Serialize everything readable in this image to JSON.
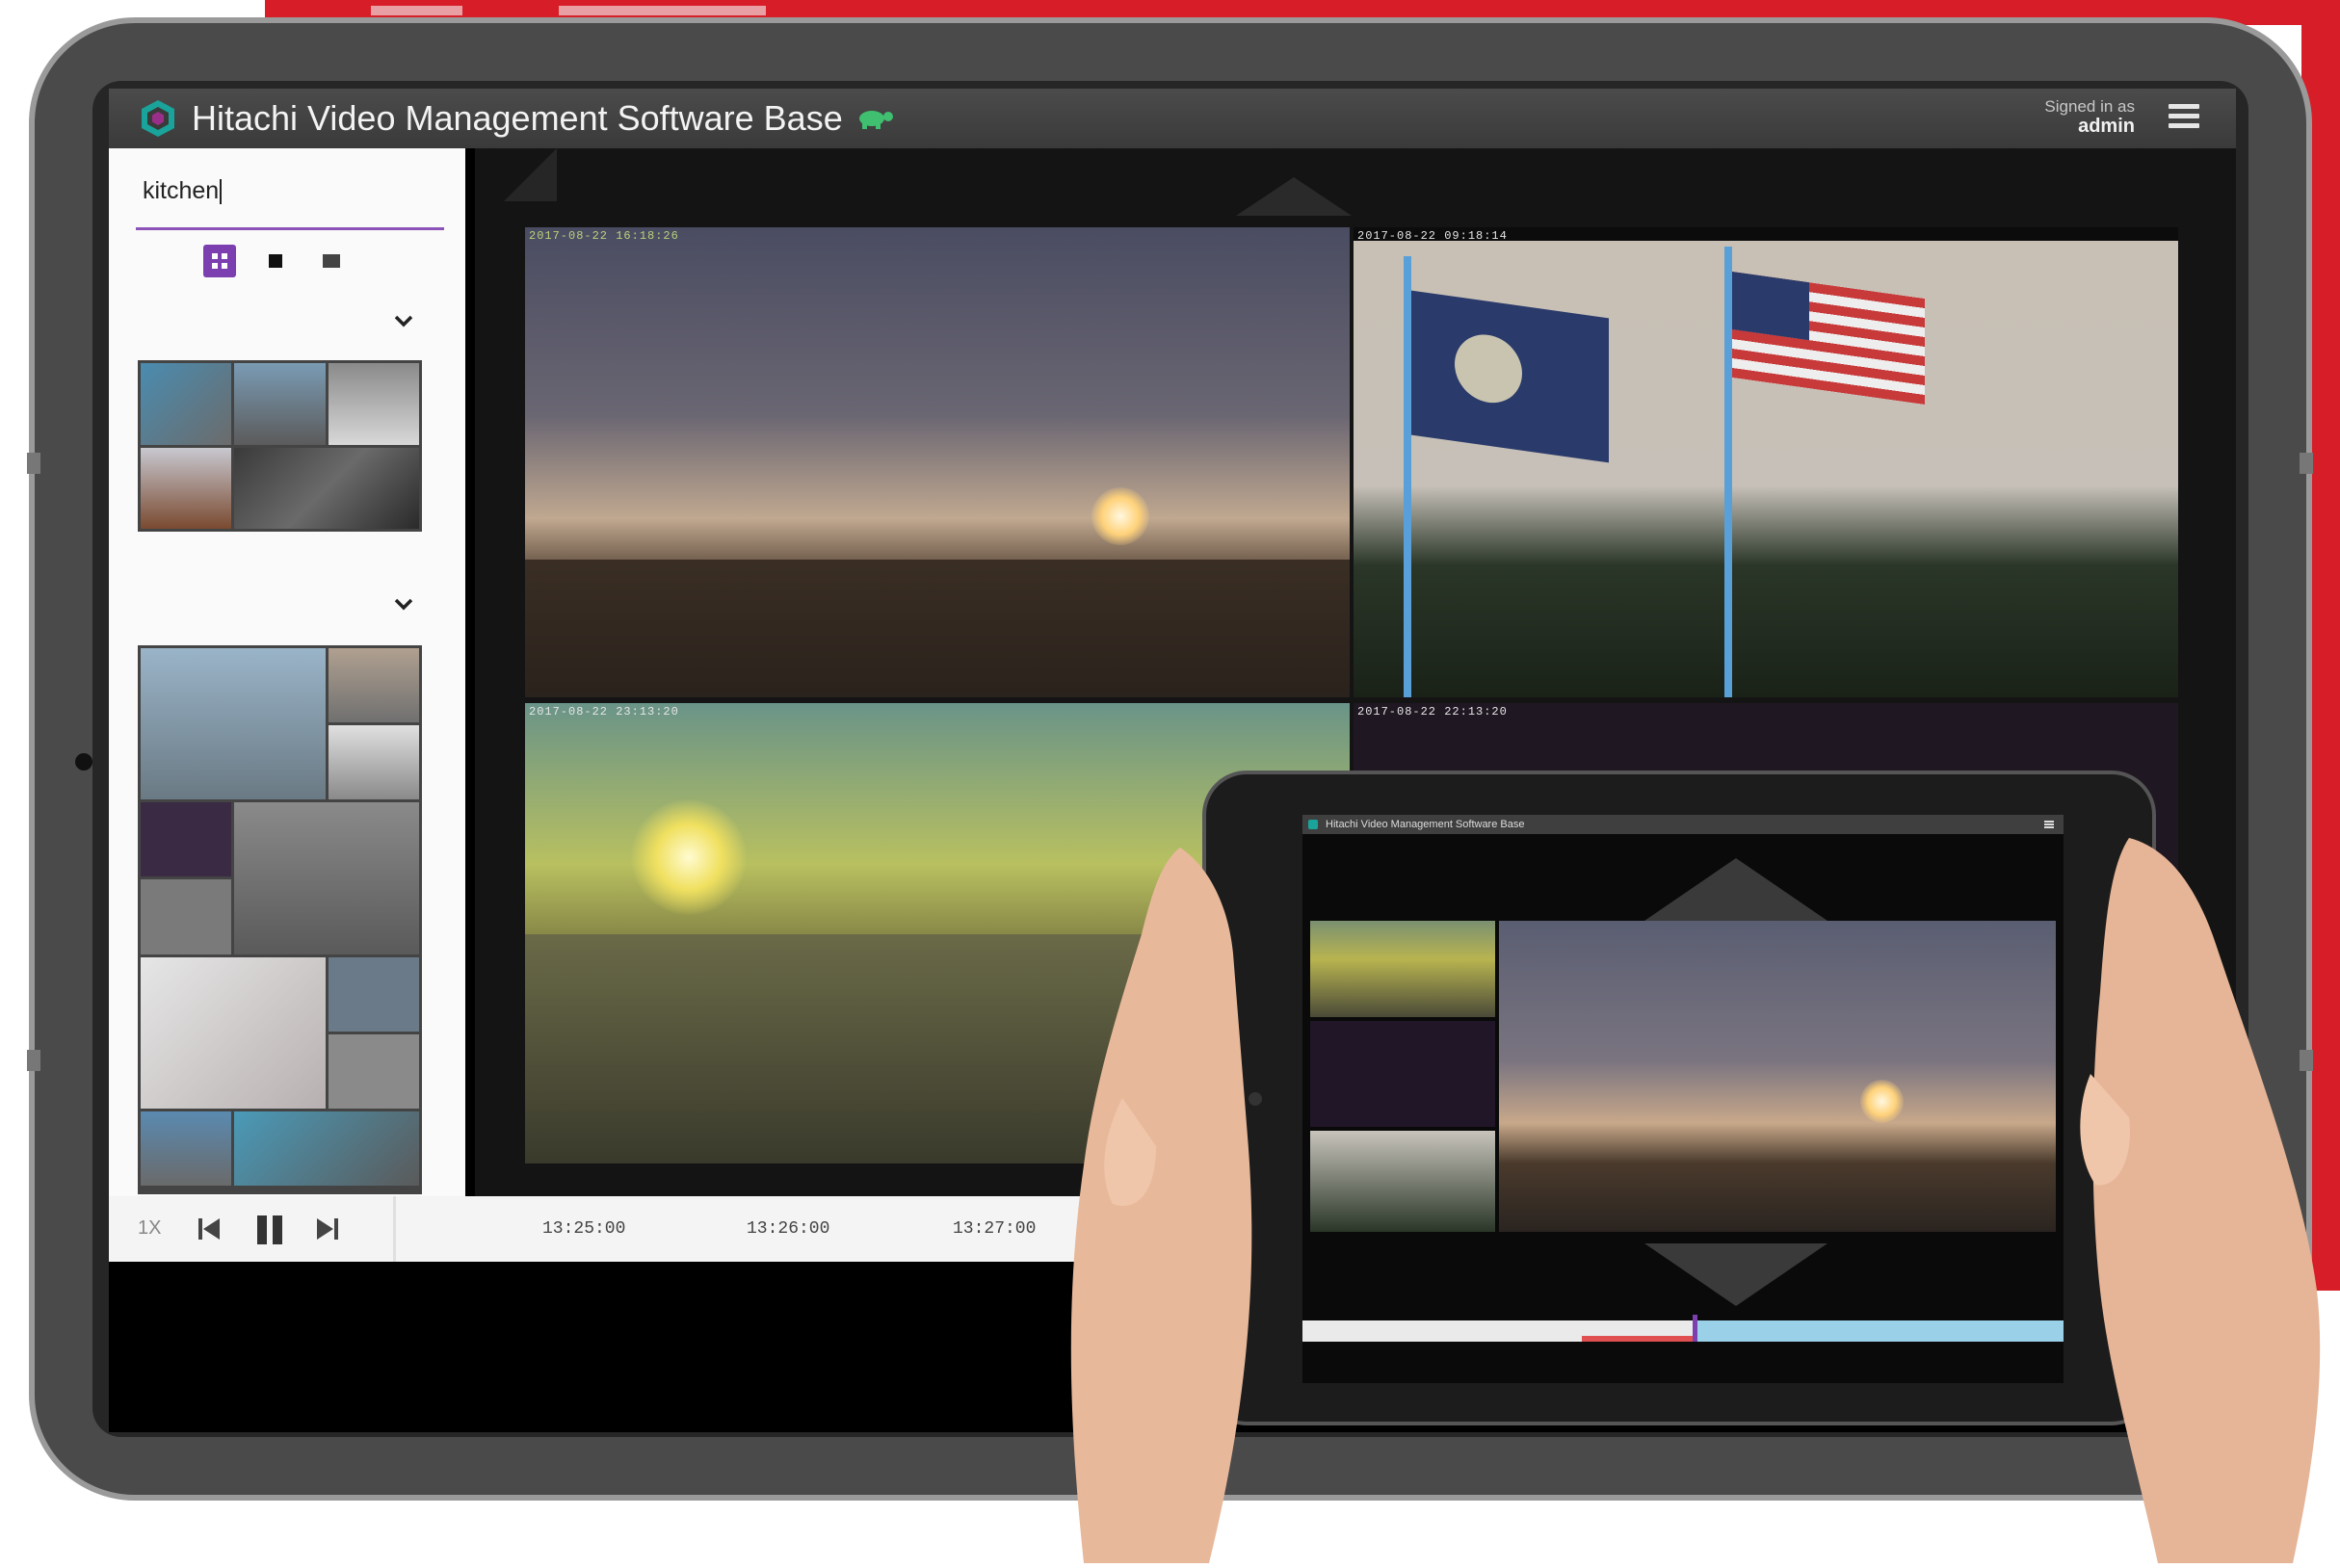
{
  "app": {
    "title": "Hitachi Video Management Software Base",
    "signed_in_label": "Signed in as",
    "user": "admin"
  },
  "sidebar": {
    "search_value": "kitchen",
    "view_modes": [
      "grid-view-icon",
      "single-view-icon",
      "list-view-icon"
    ],
    "active_view": "grid"
  },
  "video_tiles": [
    {
      "timestamp": "2017-08-22 16:18:26",
      "scene": "sunset-parking-lot"
    },
    {
      "timestamp": "2017-08-22 09:18:14",
      "scene": "flags"
    },
    {
      "timestamp": "2017-08-22 23:13:20",
      "scene": "sun-courtyard"
    },
    {
      "timestamp": "2017-08-22 22:13:20",
      "scene": "dark"
    }
  ],
  "playback": {
    "speed": "1X",
    "timeline_labels": [
      "13:25:00",
      "13:26:00",
      "13:27:00"
    ]
  },
  "tablet": {
    "title": "Hitachi Video Management Software Base"
  },
  "colors": {
    "accent": "#7b3fb0",
    "brand_red": "#d71e28",
    "topbar": "#404040"
  }
}
